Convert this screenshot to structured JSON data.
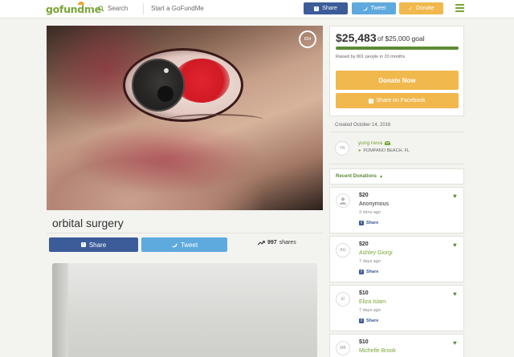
{
  "header": {
    "logo_text_1": "gofund",
    "logo_text_2": "me",
    "search_label": "Search",
    "start_label": "Start a GoFundMe",
    "share_label": "Share",
    "tweet_label": "Tweet",
    "donate_label": "Donate"
  },
  "campaign": {
    "title": "orbital surgery",
    "heart_count": "834",
    "share_button": "Share",
    "tweet_button": "Tweet",
    "shares_count": "997",
    "shares_label": "shares"
  },
  "sidebar": {
    "amount": "$25,483",
    "goal": "of $25,000 goal",
    "progress_fraction": 1.0,
    "raised_text": "Raised by 801 people in 20 months",
    "donate_now": "Donate Now",
    "share_facebook": "Share on Facebook",
    "created": "Created October 14, 2016",
    "organizer_initials": "YN",
    "organizer_name": "yung neva",
    "organizer_location": "POMPANO BEACH, FL",
    "recent_donations_label": "Recent Donations"
  },
  "donations": [
    {
      "initials": "",
      "amount": "$20",
      "name": "Anonymous",
      "time": "3 mins ago",
      "share": "Share"
    },
    {
      "initials": "AG",
      "amount": "$20",
      "name": "Ashley Giorgi",
      "time": "7 days ago",
      "share": "Share"
    },
    {
      "initials": "EI",
      "amount": "$10",
      "name": "Eliza Islam",
      "time": "7 days ago",
      "share": "Share"
    },
    {
      "initials": "MB",
      "amount": "$10",
      "name": "Michelle Brook",
      "time": "",
      "share": ""
    }
  ],
  "colors": {
    "brand_green": "#7aa536",
    "facebook": "#3b5b99",
    "twitter": "#5ea9dd",
    "donate": "#f0b84d"
  }
}
